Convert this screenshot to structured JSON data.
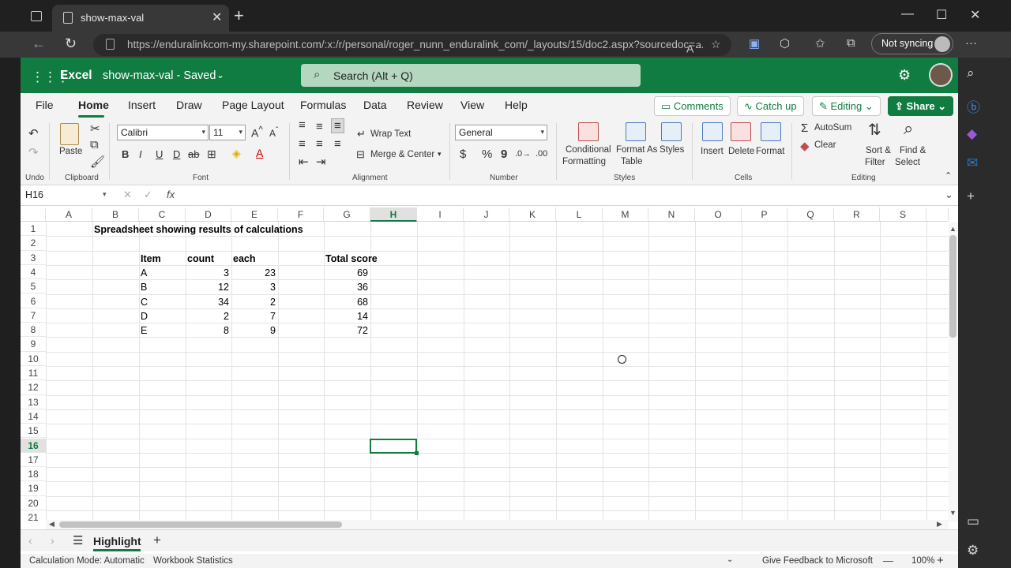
{
  "browser": {
    "tab_title": "show-max-val",
    "url": "https://enduralinkcom-my.sharepoint.com/:x:/r/personal/roger_nunn_enduralink_com/_layouts/15/doc2.aspx?sourcedoc=...",
    "sync_label": "Not syncing",
    "icons": [
      "tab-actions-icon",
      "page-icon",
      "close-icon",
      "plus-icon",
      "back-arrow-icon",
      "refresh-icon",
      "lock-icon",
      "read-aloud-icon",
      "add-favorite-icon",
      "extensions-icon",
      "favorites-icon",
      "collections-icon",
      "more-icon"
    ]
  },
  "excel": {
    "app_name": "Excel",
    "doc_title": "show-max-val  -  Saved",
    "search_placeholder": "Search (Alt + Q)",
    "ribbon_tabs": [
      "File",
      "Home",
      "Insert",
      "Draw",
      "Page Layout",
      "Formulas",
      "Data",
      "Review",
      "View",
      "Help"
    ],
    "active_tab": "Home",
    "header_buttons": {
      "comments": "Comments",
      "catch_up": "Catch up",
      "editing": "Editing",
      "share": "Share"
    },
    "ribbon": {
      "undo_label": "Undo",
      "clipboard_label": "Clipboard",
      "paste_label": "Paste",
      "font_label": "Font",
      "font_name": "Calibri",
      "font_size": "11",
      "alignment_label": "Alignment",
      "wrap_text": "Wrap Text",
      "merge_center": "Merge & Center",
      "number_label": "Number",
      "number_format": "General",
      "styles_label": "Styles",
      "conditional_formatting_1": "Conditional",
      "conditional_formatting_2": "Formatting",
      "format_as_table_1": "Format As",
      "format_as_table_2": "Table",
      "styles_btn": "Styles",
      "cells_label": "Cells",
      "insert": "Insert",
      "delete": "Delete",
      "format": "Format",
      "editing_label": "Editing",
      "autosum": "AutoSum",
      "clear": "Clear",
      "sort_filter_1": "Sort &",
      "sort_filter_2": "Filter",
      "find_select_1": "Find &",
      "find_select_2": "Select"
    },
    "name_box": "H16",
    "fx_label": "fx",
    "columns": [
      "A",
      "B",
      "C",
      "D",
      "E",
      "F",
      "G",
      "H",
      "I",
      "J",
      "K",
      "L",
      "M",
      "N",
      "O",
      "P",
      "Q",
      "R",
      "S"
    ],
    "selected_column": "H",
    "rows": [
      "1",
      "2",
      "3",
      "4",
      "5",
      "6",
      "7",
      "8",
      "9",
      "10",
      "11",
      "12",
      "13",
      "14",
      "15",
      "16",
      "17",
      "18",
      "19",
      "20",
      "21"
    ],
    "selected_row": "16",
    "cells": {
      "B1": "Spreadsheet showing results of calculations",
      "C3": "Item",
      "D3": "count",
      "E3": "each",
      "G3": "Total score",
      "data": [
        {
          "item": "A",
          "count": "3",
          "each": "23",
          "total": "69"
        },
        {
          "item": "B",
          "count": "12",
          "each": "3",
          "total": "36"
        },
        {
          "item": "C",
          "count": "34",
          "each": "2",
          "total": "68"
        },
        {
          "item": "D",
          "count": "2",
          "each": "7",
          "total": "14"
        },
        {
          "item": "E",
          "count": "8",
          "each": "9",
          "total": "72"
        }
      ]
    },
    "sheet_tab": "Highlight",
    "status": {
      "calc_mode": "Calculation Mode: Automatic",
      "workbook_stats": "Workbook Statistics",
      "feedback": "Give Feedback to Microsoft",
      "zoom": "100%"
    }
  },
  "colors": {
    "excel_green": "#107c41",
    "browser_dark": "#202020"
  }
}
